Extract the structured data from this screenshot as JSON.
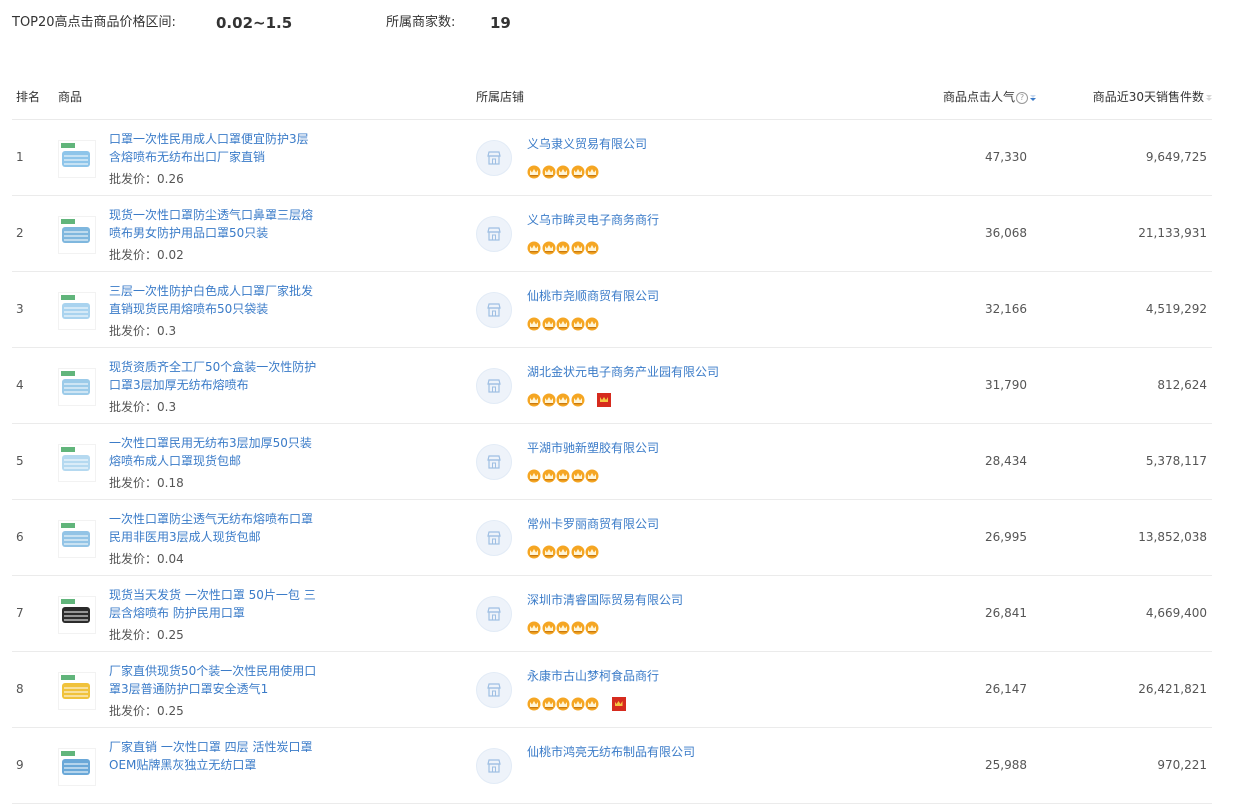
{
  "summary": {
    "price_range_label": "TOP20高点击商品价格区间:",
    "price_range_value": "0.02~1.5",
    "merchant_count_label": "所属商家数:",
    "merchant_count_value": "19"
  },
  "table": {
    "columns": {
      "rank": "排名",
      "product": "商品",
      "shop": "所属店铺",
      "clicks": "商品点击人气",
      "sales": "商品近30天销售件数"
    },
    "price_prefix": "批发价：",
    "rows": [
      {
        "rank": "1",
        "title": "口罩一次性民用成人口罩便宜防护3层含熔喷布无纺布出口厂家直销",
        "price": "批发价：0.26",
        "shop": "义乌隶义贸易有限公司",
        "crowns": 5,
        "extra_badge": false,
        "clicks": "47,330",
        "sales": "9,649,725"
      },
      {
        "rank": "2",
        "title": "现货一次性口罩防尘透气口鼻罩三层熔喷布男女防护用品口罩50只装",
        "price": "批发价：0.02",
        "shop": "义乌市眸灵电子商务商行",
        "crowns": 5,
        "extra_badge": false,
        "clicks": "36,068",
        "sales": "21,133,931"
      },
      {
        "rank": "3",
        "title": "三层一次性防护白色成人口罩厂家批发直销现货民用熔喷布50只袋装",
        "price": "批发价：0.3",
        "shop": "仙桃市尧顺商贸有限公司",
        "crowns": 5,
        "extra_badge": false,
        "clicks": "32,166",
        "sales": "4,519,292"
      },
      {
        "rank": "4",
        "title": "现货资质齐全工厂50个盒装一次性防护口罩3层加厚无纺布熔喷布",
        "price": "批发价：0.3",
        "shop": "湖北金状元电子商务产业园有限公司",
        "crowns": 4,
        "extra_badge": true,
        "clicks": "31,790",
        "sales": "812,624"
      },
      {
        "rank": "5",
        "title": "一次性口罩民用无纺布3层加厚50只装熔喷布成人口罩现货包邮",
        "price": "批发价：0.18",
        "shop": "平湖市驰新塑胶有限公司",
        "crowns": 5,
        "extra_badge": false,
        "clicks": "28,434",
        "sales": "5,378,117"
      },
      {
        "rank": "6",
        "title": "一次性口罩防尘透气无纺布熔喷布口罩民用非医用3层成人现货包邮",
        "price": "批发价：0.04",
        "shop": "常州卡罗丽商贸有限公司",
        "crowns": 5,
        "extra_badge": false,
        "clicks": "26,995",
        "sales": "13,852,038"
      },
      {
        "rank": "7",
        "title": "现货当天发货 一次性口罩 50片一包 三层含熔喷布 防护民用口罩",
        "price": "批发价：0.25",
        "shop": "深圳市清睿国际贸易有限公司",
        "crowns": 5,
        "extra_badge": false,
        "clicks": "26,841",
        "sales": "4,669,400"
      },
      {
        "rank": "8",
        "title": "厂家直供现货50个装一次性民用使用口罩3层普通防护口罩安全透气1",
        "price": "批发价：0.25",
        "shop": "永康市古山梦柯食品商行",
        "crowns": 5,
        "extra_badge": true,
        "clicks": "26,147",
        "sales": "26,421,821"
      },
      {
        "rank": "9",
        "title": "厂家直销 一次性口罩 四层 活性炭口罩 OEM贴牌黑灰独立无纺口罩",
        "price": "",
        "shop": "仙桃市鸿亮无纺布制品有限公司",
        "crowns": 0,
        "extra_badge": false,
        "clicks": "25,988",
        "sales": "970,221"
      }
    ]
  },
  "colors": {
    "link": "#3a7bc8",
    "crown": "#f5a623",
    "badge": "#d62b1e"
  },
  "icons": {
    "shop": "shop-storefront-icon",
    "crown": "crown-icon",
    "sort": "sort-descending-icon",
    "help": "help-circle-icon"
  }
}
